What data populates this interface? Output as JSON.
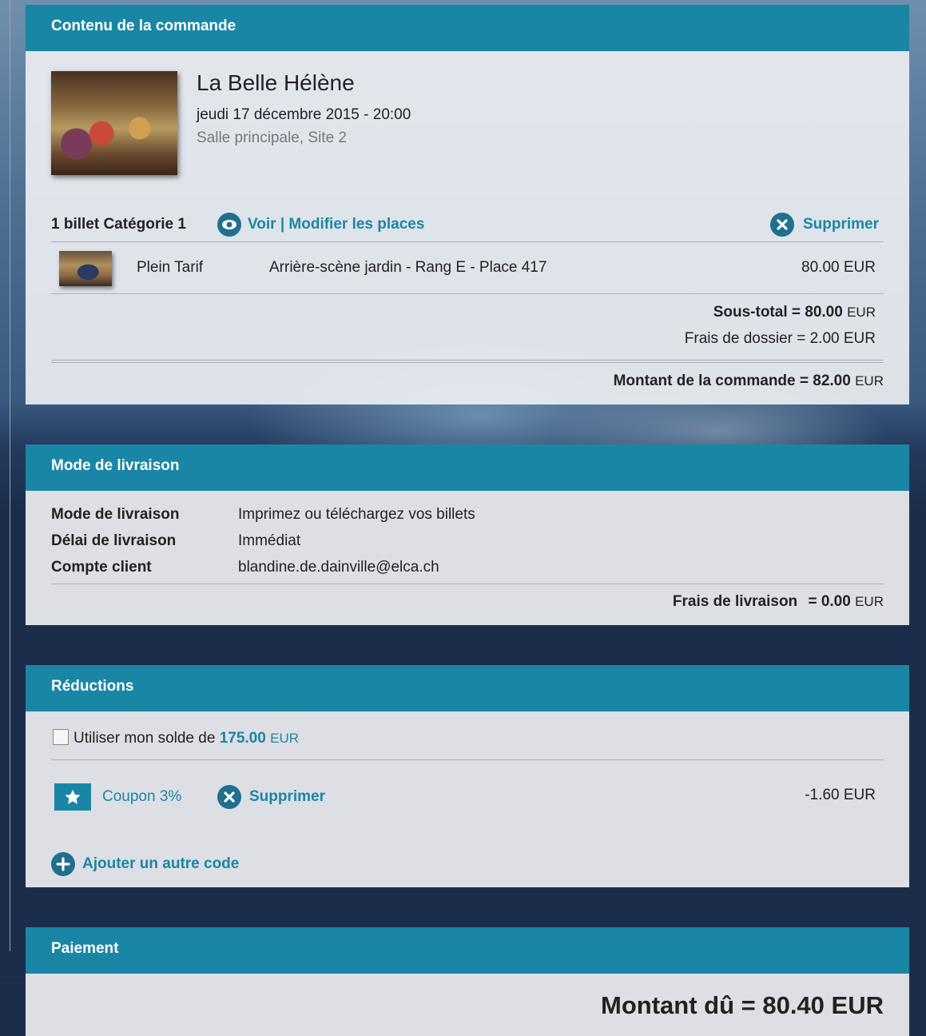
{
  "order": {
    "header": "Contenu de la commande",
    "show": {
      "title": "La Belle Hélène",
      "date": "jeudi 17 décembre 2015 - 20:00",
      "venue": "Salle principale, Site 2"
    },
    "ticket_group": {
      "label": "1 billet Catégorie 1",
      "view_link": "Voir | Modifier les places",
      "delete_link": "Supprimer"
    },
    "ticket": {
      "tariff": "Plein Tarif",
      "seat": "Arrière-scène jardin - Rang E - Place 417",
      "price": "80.00",
      "currency": "EUR"
    },
    "subtotal": {
      "label": "Sous-total = 80.00",
      "currency": "EUR"
    },
    "fees": {
      "label": "Frais de dossier = 2.00",
      "currency": "EUR"
    },
    "total": {
      "label": "Montant de la commande = 82.00",
      "currency": "EUR"
    }
  },
  "delivery": {
    "header": "Mode de livraison",
    "rows": [
      {
        "label": "Mode de livraison",
        "value": "Imprimez ou téléchargez vos billets"
      },
      {
        "label": "Délai de livraison",
        "value": "Immédiat"
      },
      {
        "label": "Compte client",
        "value": "blandine.de.dainville@elca.ch"
      }
    ],
    "fee": {
      "label": "Frais de livraison",
      "amount": "= 0.00",
      "currency": "EUR"
    }
  },
  "reductions": {
    "header": "Réductions",
    "balance": {
      "label": "Utiliser mon solde de",
      "amount": "175.00",
      "currency": "EUR",
      "checked": false
    },
    "coupon": {
      "name": "Coupon 3%",
      "delete_link": "Supprimer",
      "amount": "-1.60 EUR"
    },
    "add_code": "Ajouter un autre code"
  },
  "payment": {
    "header": "Paiement",
    "due": {
      "label": "Montant dû = 80.40",
      "currency": "EUR"
    }
  },
  "colors": {
    "accent": "#1a86a5",
    "icon": "#1f6f8f",
    "background": "#1b2d4a"
  },
  "icons": {
    "view": "eye-icon",
    "delete": "close-icon",
    "coupon": "star-icon",
    "add": "plus-icon"
  }
}
